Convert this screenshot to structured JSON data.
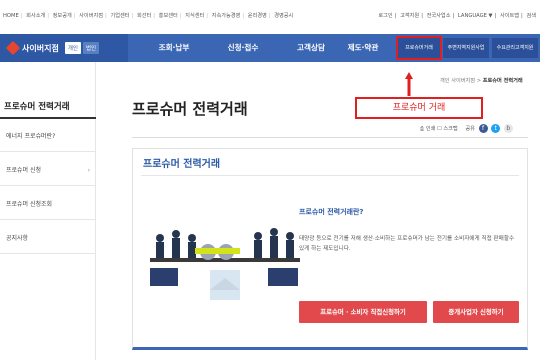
{
  "topbar": {
    "left_links": [
      "HOME",
      "회사소개",
      "정보공개",
      "사이버지점",
      "기업센터",
      "회선터",
      "홍보센터",
      "지식센터",
      "지속가능경영",
      "윤리경영",
      "경영공시"
    ],
    "right_links": [
      "로그인",
      "고객지원",
      "전국사업소",
      "LANGUAGE ▼",
      "사이트맵",
      "검색"
    ]
  },
  "nav": {
    "brand_title": "사이버지점",
    "pill_personal": "개인",
    "pill_corp": "법인",
    "items": [
      "조회·납부",
      "신청·접수",
      "고객상담",
      "제도·약관"
    ],
    "subitems": [
      "프로슈머거래",
      "주변지역지원사업",
      "수요관리고객지원"
    ]
  },
  "sidebar": {
    "heading": "프로슈머 전력거래",
    "items": [
      {
        "label": "에너지 프로슈머란?",
        "arrow": ""
      },
      {
        "label": "프로슈머 신청",
        "arrow": "›"
      },
      {
        "label": "프로슈머 신청조회",
        "arrow": ""
      },
      {
        "label": "공지사항",
        "arrow": ""
      }
    ]
  },
  "breadcrumb": {
    "path": "개인 사이버지점 > ",
    "current": "프로슈머 전력거래"
  },
  "page": {
    "title": "프로슈머 전력거래",
    "callout": "프로슈머 거래",
    "tools": {
      "print": "인쇄",
      "scrap": "스크랩",
      "share": "공유"
    }
  },
  "card": {
    "title": "프로슈머 전력거래",
    "question": "프로슈머 전력거래란?",
    "description": "태양광 등으로 전기를 저해 생산·소비하는 프로슈머가 남는 전기를 소비자에게 직접 판매할수 있게 하는 제도입니다.",
    "button_primary": "프로슈머 · 소비자 직접신청하기",
    "button_secondary": "중개사업자 신청하기"
  },
  "colors": {
    "nav_blue": "#3a66b3",
    "brand_blue": "#2e57a4",
    "accent_red": "#e02020",
    "button_red": "#e2494c",
    "title_blue": "#2c5aa7"
  }
}
